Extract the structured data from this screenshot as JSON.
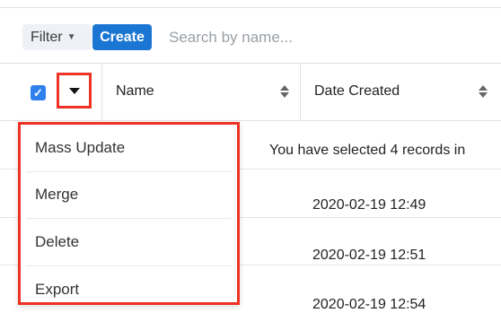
{
  "toolbar": {
    "filter_label": "Filter",
    "create_label": "Create",
    "search_placeholder": "Search by name..."
  },
  "table": {
    "columns": [
      "Name",
      "Date Created"
    ],
    "selection_message": "You have selected 4 records in",
    "rows": [
      {
        "date_created": "2020-02-19 12:49"
      },
      {
        "date_created": "2020-02-19 12:51"
      },
      {
        "date_created": "2020-02-19 12:54"
      }
    ]
  },
  "dropdown": {
    "items": [
      "Mass Update",
      "Merge",
      "Delete",
      "Export"
    ]
  },
  "colors": {
    "accent": "#1a76d2",
    "highlight_border": "#ee3224",
    "checkbox": "#2f80ed"
  }
}
